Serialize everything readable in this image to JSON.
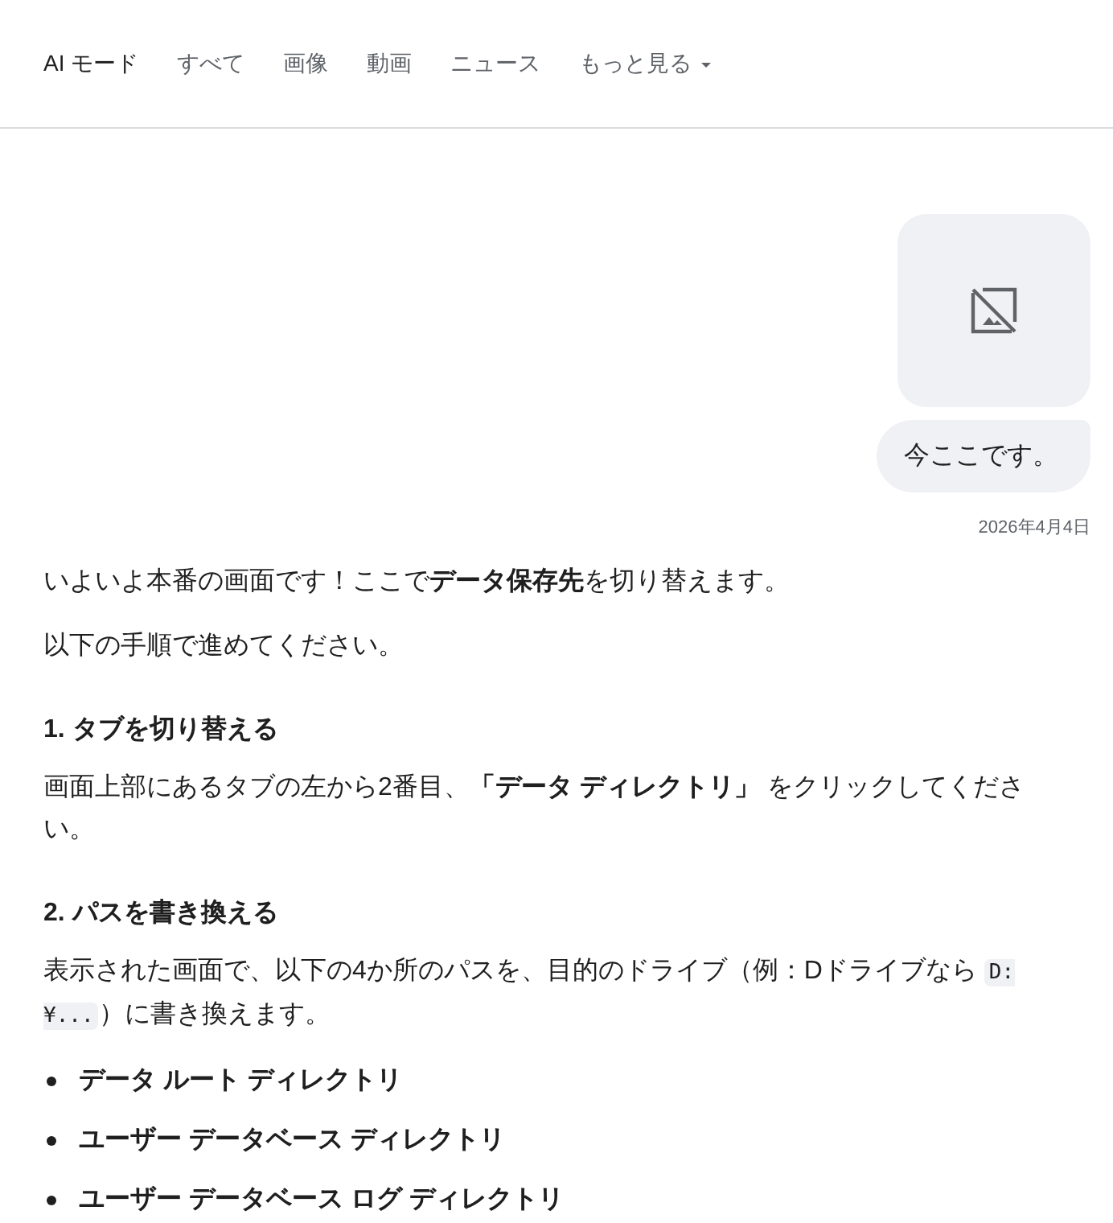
{
  "tabs": [
    {
      "label": "AI モード",
      "selected": true
    },
    {
      "label": "すべて",
      "selected": false
    },
    {
      "label": "画像",
      "selected": false
    },
    {
      "label": "動画",
      "selected": false
    },
    {
      "label": "ニュース",
      "selected": false
    },
    {
      "label": "もっと見る",
      "selected": false,
      "kind": "dropdown"
    }
  ],
  "user_message": {
    "text": "今ここです。",
    "date": "2026年4月4日"
  },
  "response": [
    {
      "kind": "paragraph",
      "text": "いよいよ本番の画面です！ここで**データ保存先**を切り替えます。"
    },
    {
      "kind": "paragraph",
      "text": "以下の手順で進めてください。"
    },
    {
      "kind": "heading",
      "text": "1. タブを切り替える"
    },
    {
      "kind": "paragraph",
      "text": "画面上部にあるタブの左から2番目、**「データ ディレクトリ」** をクリックしてください。"
    },
    {
      "kind": "heading",
      "text": "2. パスを書き換える"
    },
    {
      "kind": "paragraph",
      "parts": [
        {
          "kind": "text",
          "text": "表示された画面で、以下の4か所のパスを、目的のドライブ（例：Dドライブなら "
        },
        {
          "kind": "code",
          "text": "D:¥..."
        },
        {
          "kind": "text",
          "text": "）に書き換えます。"
        }
      ]
    },
    {
      "kind": "list",
      "items": [
        "データ ルート ディレクトリ",
        "ユーザー データベース ディレクトリ",
        "ユーザー データベース ログ ディレクトリ"
      ]
    }
  ]
}
